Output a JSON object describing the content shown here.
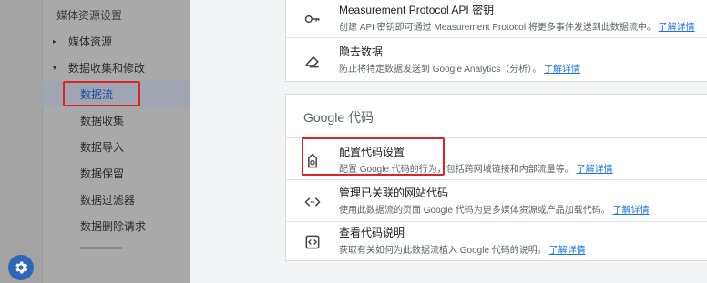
{
  "sidebar": {
    "section_title": "媒体资源设置",
    "items": [
      {
        "label": "媒体资源",
        "arrow": "▸"
      },
      {
        "label": "数据收集和修改",
        "arrow": "▾"
      },
      {
        "label": "数据流"
      },
      {
        "label": "数据收集"
      },
      {
        "label": "数据导入"
      },
      {
        "label": "数据保留"
      },
      {
        "label": "数据过滤器"
      },
      {
        "label": "数据删除请求"
      }
    ]
  },
  "card1": {
    "rows": [
      {
        "title": "Measurement Protocol API 密钥",
        "desc": "创建 API 密钥即可通过 Measurement Protocol 将更多事件发送到此数据流中。",
        "link": "了解详情"
      },
      {
        "title": "隐去数据",
        "desc": "防止将特定数据发送到 Google Analytics（分析）。",
        "link": "了解详情"
      }
    ]
  },
  "card2": {
    "header": "Google 代码",
    "rows": [
      {
        "title": "配置代码设置",
        "desc": "配置 Google 代码的行为，包括跨网域链接和内部流量等。",
        "link": "了解详情"
      },
      {
        "title": "管理已关联的网站代码",
        "desc": "使用此数据流的页面 Google 代码为更多媒体资源或产品加载代码。",
        "link": "了解详情"
      },
      {
        "title": "查看代码说明",
        "desc": "获取有关如何为此数据流植入 Google 代码的说明。",
        "link": "了解详情"
      }
    ]
  },
  "colors": {
    "accent": "#1a73e8",
    "highlight": "#e02424",
    "active_text": "#174ea6"
  },
  "icons": [
    "key-icon",
    "eraser-icon",
    "tag-icon",
    "code-icon",
    "code-box-icon",
    "gear-icon"
  ]
}
